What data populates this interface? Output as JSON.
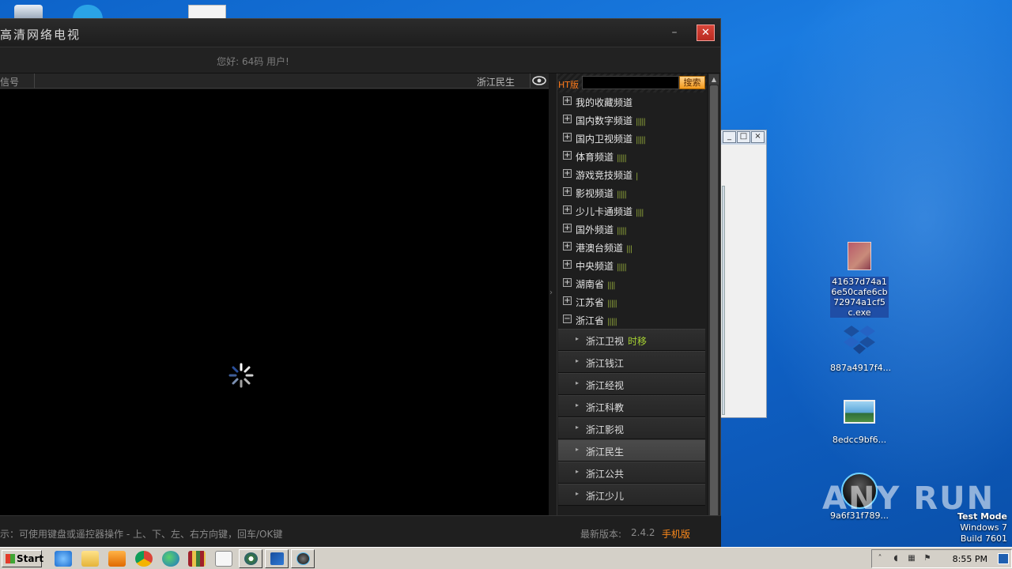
{
  "app": {
    "title": "高清网络电视",
    "greeting": "您好: 64码 用户!",
    "signal_label": "信号",
    "current_channel": "浙江民生",
    "search_label": "HT版",
    "search_placeholder": "",
    "search_button": "搜索",
    "categories": [
      {
        "label": "我的收藏频道",
        "bars": "",
        "expanded": false
      },
      {
        "label": "国内数字频道",
        "bars": "|||||",
        "expanded": false
      },
      {
        "label": "国内卫视频道",
        "bars": "|||||",
        "expanded": false
      },
      {
        "label": "体育频道",
        "bars": "|||||",
        "expanded": false
      },
      {
        "label": "游戏竞技频道",
        "bars": "|",
        "expanded": false
      },
      {
        "label": "影视频道",
        "bars": "|||||",
        "expanded": false
      },
      {
        "label": "少儿卡通频道",
        "bars": "||||",
        "expanded": false
      },
      {
        "label": "国外频道",
        "bars": "|||||",
        "expanded": false
      },
      {
        "label": "港澳台频道",
        "bars": "|||",
        "expanded": false
      },
      {
        "label": "中央频道",
        "bars": "|||||",
        "expanded": false
      },
      {
        "label": "湖南省",
        "bars": "||||",
        "expanded": false
      },
      {
        "label": "江苏省",
        "bars": "|||||",
        "expanded": false
      },
      {
        "label": "浙江省",
        "bars": "|||||",
        "expanded": true
      }
    ],
    "sub_channels": [
      {
        "label": "浙江卫视",
        "tag": "时移",
        "active": false
      },
      {
        "label": "浙江钱江",
        "tag": "",
        "active": false
      },
      {
        "label": "浙江经视",
        "tag": "",
        "active": false
      },
      {
        "label": "浙江科教",
        "tag": "",
        "active": false
      },
      {
        "label": "浙江影视",
        "tag": "",
        "active": false
      },
      {
        "label": "浙江民生",
        "tag": "",
        "active": true
      },
      {
        "label": "浙江公共",
        "tag": "",
        "active": false
      },
      {
        "label": "浙江少儿",
        "tag": "",
        "active": false
      }
    ],
    "tip": "示：可使用键盘或遥控器操作 - 上、下、左、右方向键，回车/OK键",
    "version_label": "最新版本:",
    "version": "2.4.2",
    "mobile_link": "手机版"
  },
  "desktop": {
    "icons": [
      {
        "label": "41637d74a16e50cafe6cb72974a1cf5c.exe",
        "icon": "exe-file-icon",
        "selected": true
      },
      {
        "label": "887a4917f4...",
        "icon": "dropbox-cube-icon",
        "selected": false
      },
      {
        "label": "8edcc9bf6...",
        "icon": "image-file-icon",
        "selected": false
      },
      {
        "label": "9a6f31f789...",
        "icon": "globe-app-icon",
        "selected": false
      }
    ],
    "watermark": "ANY RUN",
    "test_mode": [
      "Test Mode",
      "Windows 7",
      "Build 7601"
    ]
  },
  "taskbar": {
    "start_label": "Start",
    "clock": "8:55 PM"
  },
  "colors": {
    "accent_orange": "#ff8a1a",
    "tag_green": "#a6d233",
    "close_red": "#c9362b",
    "desktop_blue": "#1a7be0"
  }
}
